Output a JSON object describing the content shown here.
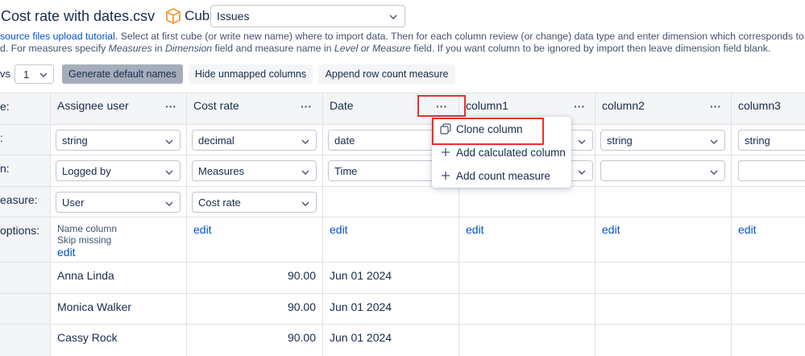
{
  "header": {
    "title": "Cost rate with dates.csv",
    "cube_label": "Cube:",
    "cube_value": "Issues"
  },
  "description": {
    "link": "source files upload tutorial",
    "line1_after": ". Select at first cube (or write new name) where to import data. Then for each column review (or change) data type and enter dimension which corresponds to",
    "line2_a": "d. For measures specify ",
    "line2_em1": "Measures",
    "line2_b": " in ",
    "line2_em2": "Dimension",
    "line2_c": " field and measure name in ",
    "line2_em3": "Level or Measure",
    "line2_d": " field. If you want column to be ignored by import then leave dimension field blank."
  },
  "toolbar": {
    "rows_label": "vs",
    "rows_value": "1",
    "generate_label": "Generate default names",
    "hide_label": "Hide unmapped columns",
    "append_label": "Append row count measure"
  },
  "row_labels": {
    "header": "e:",
    "type": ":",
    "dimension": "n:",
    "measure": "easure:",
    "options": " options:"
  },
  "columns": [
    {
      "name": "Assignee user",
      "type": "string",
      "dimension": "Logged by",
      "measure": "User",
      "options": [
        "Name column",
        "Skip missing"
      ],
      "edit": "edit"
    },
    {
      "name": "Cost rate",
      "type": "decimal",
      "dimension": "Measures",
      "measure": "Cost rate",
      "edit": "edit"
    },
    {
      "name": "Date",
      "type": "date",
      "dimension": "Time",
      "edit": "edit"
    },
    {
      "name": "column1",
      "type": "",
      "dimension": "",
      "edit": "edit"
    },
    {
      "name": "column2",
      "type": "string",
      "dimension": "",
      "edit": "edit"
    },
    {
      "name": "column3",
      "type": "string",
      "dimension": "",
      "edit": "edit"
    }
  ],
  "data_rows": [
    {
      "assignee": "Anna Linda",
      "cost": "90.00",
      "date": "Jun 01 2024"
    },
    {
      "assignee": "Monica Walker",
      "cost": "90.00",
      "date": "Jun 01 2024"
    },
    {
      "assignee": "Cassy Rock",
      "cost": "90.00",
      "date": "Jun 01 2024"
    }
  ],
  "menu": {
    "items": [
      "Clone column",
      "Add calculated column",
      "Add count measure"
    ]
  },
  "colors": {
    "link": "#0052cc",
    "highlight": "#e5322d",
    "cube_icon": "#f29d38"
  }
}
